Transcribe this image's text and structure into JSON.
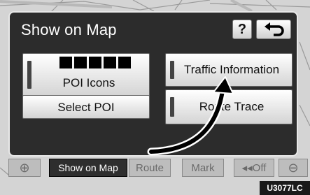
{
  "header": {
    "title": "Show on Map",
    "help_label": "?"
  },
  "menu": {
    "poi_icons_label": "POI Icons",
    "select_poi_label": "Select POI",
    "traffic_info_label": "Traffic Information",
    "route_trace_label": "Route Trace"
  },
  "tabs": {
    "zoom_in": "⊕",
    "show_on_map": "Show on Map",
    "route": "Route",
    "mark": "Mark",
    "off": "◂◂Off",
    "zoom_out": "⊖"
  },
  "figure_code": "U3077LC",
  "icons": {
    "help": "question-mark-icon",
    "back": "return-arrow-icon",
    "annotation": "curved-arrow"
  }
}
